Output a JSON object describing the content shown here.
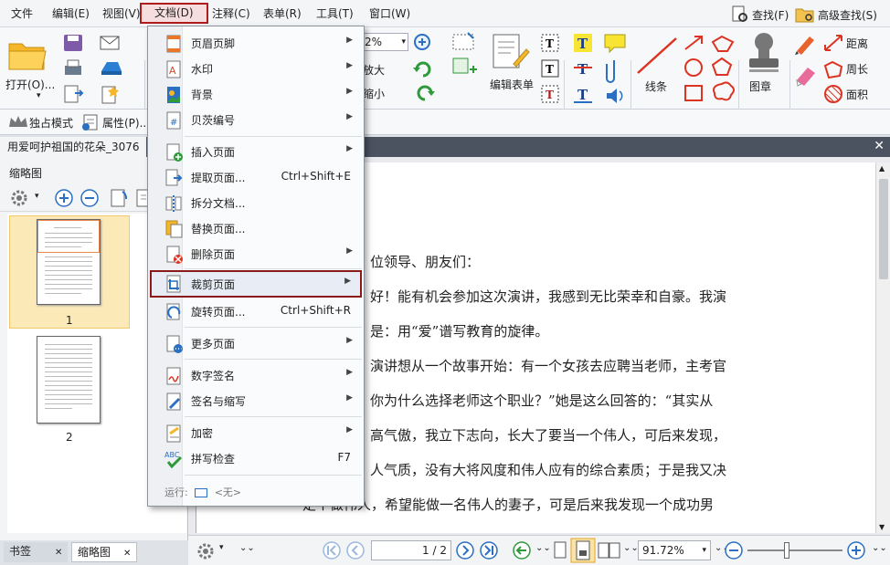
{
  "menubar": {
    "items": [
      "文件",
      "编辑(E)",
      "视图(V)",
      "文档(D)",
      "注释(C)",
      "表单(R)",
      "工具(T)",
      "窗口(W)"
    ],
    "search_label": "查找(F)",
    "advanced_search_label": "高级查找(S)"
  },
  "ribbon": {
    "open_label": "打开(O)...",
    "zoom_value": "2%",
    "zoom_in_label": "放大",
    "zoom_out_label": "缩小",
    "edit_form_label": "编辑表单",
    "lines_label": "线条",
    "stamp_label": "图章",
    "distance_label": "距离",
    "perimeter_label": "周长",
    "area_label": "面积",
    "exclusive_mode_label": "独占模式",
    "properties_label": "属性(P)..."
  },
  "document_tab": {
    "title": "用爱呵护祖国的花朵_3076"
  },
  "left_pane": {
    "title": "缩略图",
    "pages": [
      "1",
      "2"
    ],
    "bottom_tabs": [
      "书签",
      "缩略图"
    ]
  },
  "document_text": [
    "位领导、朋友们：",
    "好！能有机会参加这次演讲，我感到无比荣幸和自豪。我演",
    "是：用“爱”谱写教育的旋律。",
    "演讲想从一个故事开始：有一个女孩去应聘当老师，主考官",
    "你为什么选择老师这个职业？”她是这么回答的：“其实从",
    "高气傲，我立下志向，长大了要当一个伟人，可后来发现，",
    "人气质，没有大将风度和伟人应有的综合素质；于是我又决",
    "定个做伟人，希望能做一名伟人的妻子，可是后来我发现一个成功男"
  ],
  "status_bar": {
    "page_input": "1 / 2",
    "zoom": "91.72%"
  },
  "document_menu": {
    "items": [
      {
        "label": "页眉页脚",
        "shortcut": "",
        "submenu": true
      },
      {
        "label": "水印",
        "shortcut": "",
        "submenu": true
      },
      {
        "label": "背景",
        "shortcut": "",
        "submenu": true
      },
      {
        "label": "贝茨编号",
        "shortcut": "",
        "submenu": true
      },
      {
        "label": "插入页面",
        "shortcut": "",
        "submenu": true
      },
      {
        "label": "提取页面...",
        "shortcut": "Ctrl+Shift+E",
        "submenu": false
      },
      {
        "label": "拆分文档...",
        "shortcut": "",
        "submenu": false
      },
      {
        "label": "替换页面...",
        "shortcut": "",
        "submenu": false
      },
      {
        "label": "删除页面",
        "shortcut": "",
        "submenu": true
      },
      {
        "label": "裁剪页面",
        "shortcut": "",
        "submenu": true
      },
      {
        "label": "旋转页面...",
        "shortcut": "Ctrl+Shift+R",
        "submenu": false
      },
      {
        "label": "更多页面",
        "shortcut": "",
        "submenu": true
      },
      {
        "label": "数字签名",
        "shortcut": "",
        "submenu": true
      },
      {
        "label": "签名与缩写",
        "shortcut": "",
        "submenu": true
      },
      {
        "label": "加密",
        "shortcut": "",
        "submenu": true
      },
      {
        "label": "拼写检查",
        "shortcut": "F7",
        "submenu": false
      }
    ],
    "run_label": "运行:",
    "run_value": "<无>",
    "spell_icon_text": "ABC"
  },
  "colors": {
    "accent_red": "#b01c1c",
    "title_bar": "#4b5361",
    "thumb_selected": "#fbe9b8"
  }
}
